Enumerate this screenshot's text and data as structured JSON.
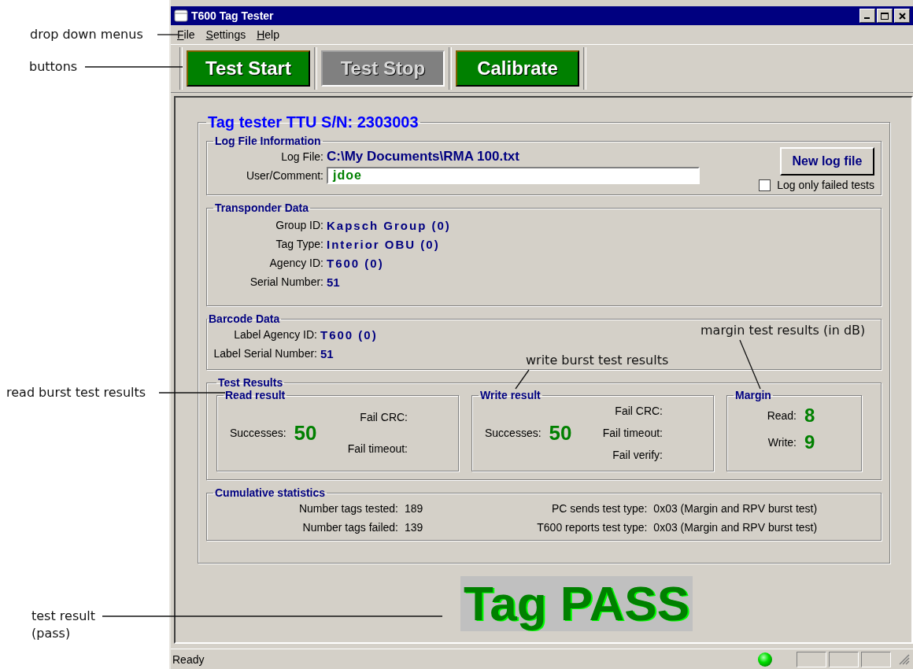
{
  "annotations": [
    {
      "lines": [
        "drop down menus"
      ]
    },
    {
      "lines": [
        "buttons"
      ]
    },
    {
      "lines": [
        "read burst test results"
      ]
    },
    {
      "lines": [
        "test result",
        "(pass)"
      ]
    },
    {
      "lines": [
        "write burst test results"
      ]
    },
    {
      "lines": [
        "margin test results (in dB)"
      ]
    }
  ],
  "window": {
    "title": "T600 Tag Tester"
  },
  "menu": [
    {
      "label": "File"
    },
    {
      "label": "Settings"
    },
    {
      "label": "Help"
    }
  ],
  "toolbar": [
    {
      "label": "Test Start",
      "disabled": false
    },
    {
      "label": "Test Stop",
      "disabled": true
    },
    {
      "label": "Calibrate",
      "disabled": false
    }
  ],
  "panel": {
    "title": "Tag tester TTU S/N: 2303003"
  },
  "log_file": {
    "title": "Log File Information",
    "file_label": "Log File:",
    "file_value": "C:\\My Documents\\RMA 100.txt",
    "comment_label": "User/Comment:",
    "comment_value": "jdoe",
    "button": "New log file",
    "checkbox": {
      "label": "Log only failed tests",
      "checked": false
    }
  },
  "transponder": {
    "title": "Transponder Data",
    "fields": [
      {
        "label": "Group ID:",
        "value": "Kapsch Group (0)",
        "spaced": true
      },
      {
        "label": "Tag Type:",
        "value": "Interior OBU (0)",
        "spaced": true
      },
      {
        "label": "Agency ID:",
        "value": "T600 (0)",
        "spaced": true
      },
      {
        "label": "Serial Number:",
        "value": "51",
        "spaced": false
      }
    ]
  },
  "barcode": {
    "title": "Barcode Data",
    "fields": [
      {
        "label": "Label Agency ID:",
        "value": "T600 (0)",
        "spaced": true
      },
      {
        "label": "Label Serial Number:",
        "value": "51",
        "spaced": false
      }
    ]
  },
  "test_results": {
    "title": "Test Results",
    "read": {
      "title": "Read result",
      "successes_label": "Successes:",
      "successes_value": "50",
      "fails": [
        "Fail CRC:",
        "Fail timeout:"
      ]
    },
    "write": {
      "title": "Write result",
      "successes_label": "Successes:",
      "successes_value": "50",
      "fails": [
        "Fail CRC:",
        "Fail timeout:",
        "Fail verify:"
      ]
    },
    "margin": {
      "title": "Margin",
      "fields": [
        {
          "label": "Read:",
          "value": "8"
        },
        {
          "label": "Write:",
          "value": "9"
        }
      ]
    }
  },
  "cumulative": {
    "title": "Cumulative statistics",
    "left": [
      {
        "label": "Number tags tested:",
        "value": "189"
      },
      {
        "label": "Number tags failed:",
        "value": "139"
      }
    ],
    "right": [
      {
        "label": "PC sends test type:",
        "value": "0x03 (Margin and RPV burst test)"
      },
      {
        "label": "T600 reports test type:",
        "value": "0x03 (Margin and RPV burst test)"
      }
    ]
  },
  "result": {
    "text": "Tag PASS",
    "passed": true
  },
  "status_bar": {
    "text": "Ready",
    "connected": true
  }
}
